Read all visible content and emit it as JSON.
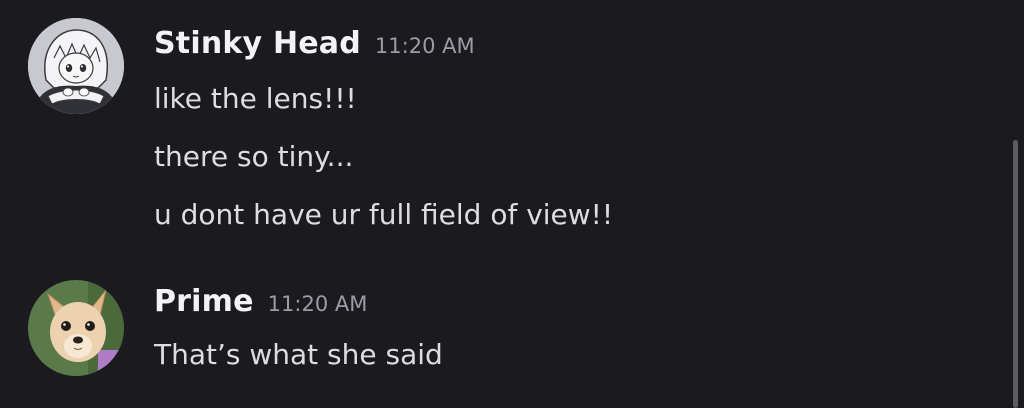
{
  "messages": [
    {
      "username": "Stinky Head",
      "timestamp": "11:20 AM",
      "avatar_icon": "anime-girl-avatar",
      "lines": [
        "like the lens!!!",
        "there so tiny...",
        "u dont have ur full field of view!!"
      ]
    },
    {
      "username": "Prime",
      "timestamp": "11:20 AM",
      "avatar_icon": "chihuahua-dog-avatar",
      "lines": [
        "That’s what she said"
      ]
    }
  ],
  "colors": {
    "background": "#1b1b1f",
    "username": "#f2f3f5",
    "message_text": "#dcdde2",
    "timestamp": "#9a9ca6",
    "scrollbar": "#5c5d63"
  }
}
